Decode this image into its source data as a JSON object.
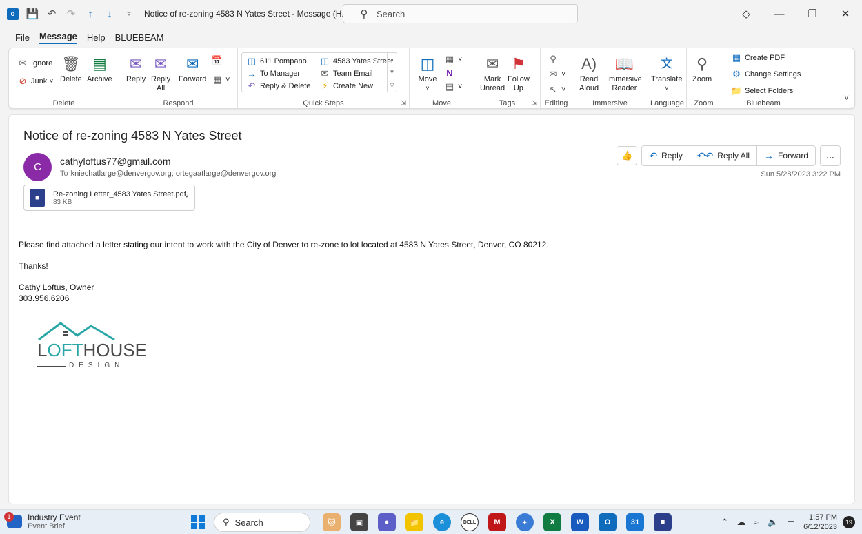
{
  "window": {
    "title": "Notice of re-zoning 4583 N Yates Street  -  Message (H...",
    "search_placeholder": "Search"
  },
  "menu": {
    "items": [
      "File",
      "Message",
      "Help",
      "BLUEBEAM"
    ],
    "active": "Message"
  },
  "ribbon": {
    "delete": {
      "label": "Delete",
      "ignore": "Ignore",
      "junk": "Junk",
      "delete_btn": "Delete",
      "archive": "Archive"
    },
    "respond": {
      "label": "Respond",
      "reply": "Reply",
      "reply_all_1": "Reply",
      "reply_all_2": "All",
      "forward": "Forward"
    },
    "quick_steps": {
      "label": "Quick Steps",
      "items": [
        "611 Pompano",
        "To Manager",
        "Reply & Delete",
        "4583 Yates Street",
        "Team Email",
        "Create New"
      ]
    },
    "move": {
      "label": "Move",
      "move_btn": "Move"
    },
    "tags": {
      "label": "Tags",
      "mark_unread_1": "Mark",
      "mark_unread_2": "Unread",
      "follow_up_1": "Follow",
      "follow_up_2": "Up"
    },
    "editing": {
      "label": "Editing"
    },
    "immersive": {
      "label": "Immersive",
      "read_aloud_1": "Read",
      "read_aloud_2": "Aloud",
      "reader_1": "Immersive",
      "reader_2": "Reader"
    },
    "language": {
      "label": "Language",
      "translate": "Translate"
    },
    "zoom": {
      "label": "Zoom",
      "zoom_btn": "Zoom"
    },
    "bluebeam": {
      "label": "Bluebeam",
      "create_pdf": "Create PDF",
      "change_settings": "Change Settings",
      "select_folders": "Select Folders"
    }
  },
  "message": {
    "subject": "Notice of re-zoning 4583 N Yates Street",
    "avatar_initial": "C",
    "sender": "cathyloftus77@gmail.com",
    "to_label": "To",
    "recipients": "kniechatlarge@denvergov.org; ortegaatlarge@denvergov.org",
    "attachment": {
      "name": "Re-zoning Letter_4583 Yates Street.pdf",
      "size": "83 KB"
    },
    "actions": {
      "reply": "Reply",
      "reply_all": "Reply All",
      "forward": "Forward"
    },
    "datetime": "Sun 5/28/2023 3:22 PM",
    "body": {
      "line1": "Please find attached a letter stating our intent to work with the City of Denver to re-zone to lot located at 4583 N Yates Street, Denver, CO 80212.",
      "line2": "Thanks!",
      "sig1": "Cathy Loftus, Owner",
      "sig2": "303.956.6206"
    },
    "logo": {
      "part1": "L",
      "part2": "OFT",
      "part3": "HOUSE",
      "sub": "DESIGN"
    }
  },
  "taskbar": {
    "widget_badge": "1",
    "widget_title": "Industry Event",
    "widget_sub": "Event Brief",
    "search": "Search",
    "time": "1:57 PM",
    "date": "6/12/2023",
    "notifications": "19"
  }
}
